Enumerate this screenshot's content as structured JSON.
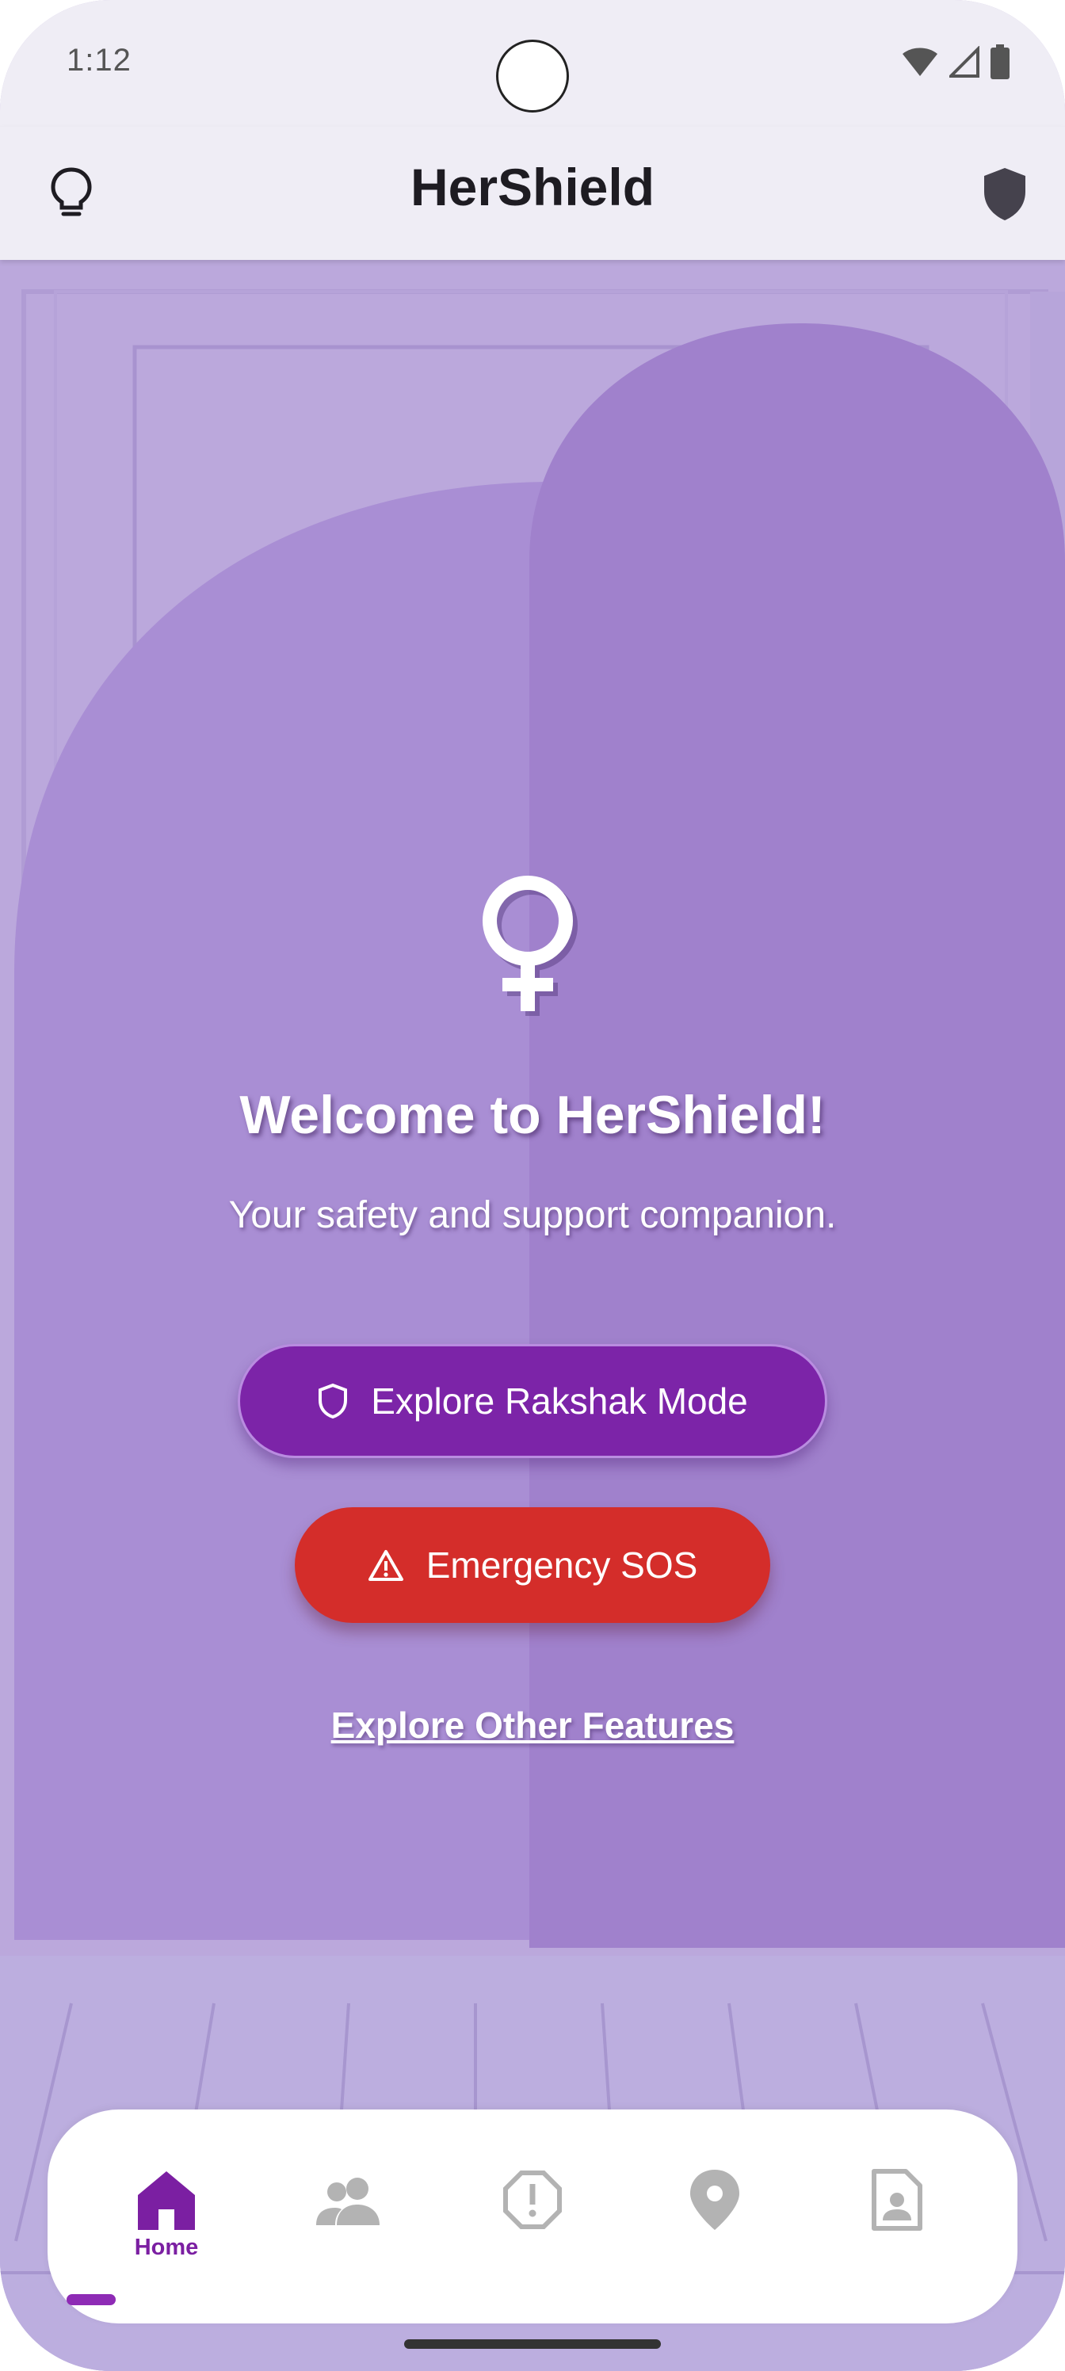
{
  "status_bar": {
    "time": "1:12"
  },
  "app_bar": {
    "title": "HerShield",
    "left_icon": "lightbulb-icon",
    "right_icon": "shield-icon"
  },
  "hero": {
    "icon": "venus-symbol-icon",
    "title": "Welcome to HerShield!",
    "subtitle": "Your safety and support companion."
  },
  "actions": {
    "rakshak": {
      "label": "Explore Rakshak Mode",
      "icon": "shield-outline-icon",
      "color": "#7c24a8"
    },
    "sos": {
      "label": "Emergency SOS",
      "icon": "warning-triangle-icon",
      "color": "#d42d2a"
    },
    "other_link": "Explore Other Features"
  },
  "bottom_nav": {
    "active_color": "#7b1fa2",
    "inactive_color": "#b3b3b3",
    "items": [
      {
        "label": "Home",
        "icon": "home-icon",
        "active": true
      },
      {
        "label": "",
        "icon": "people-icon",
        "active": false
      },
      {
        "label": "",
        "icon": "alert-octagon-icon",
        "active": false
      },
      {
        "label": "",
        "icon": "location-pin-icon",
        "active": false
      },
      {
        "label": "",
        "icon": "contact-card-icon",
        "active": false
      }
    ]
  }
}
